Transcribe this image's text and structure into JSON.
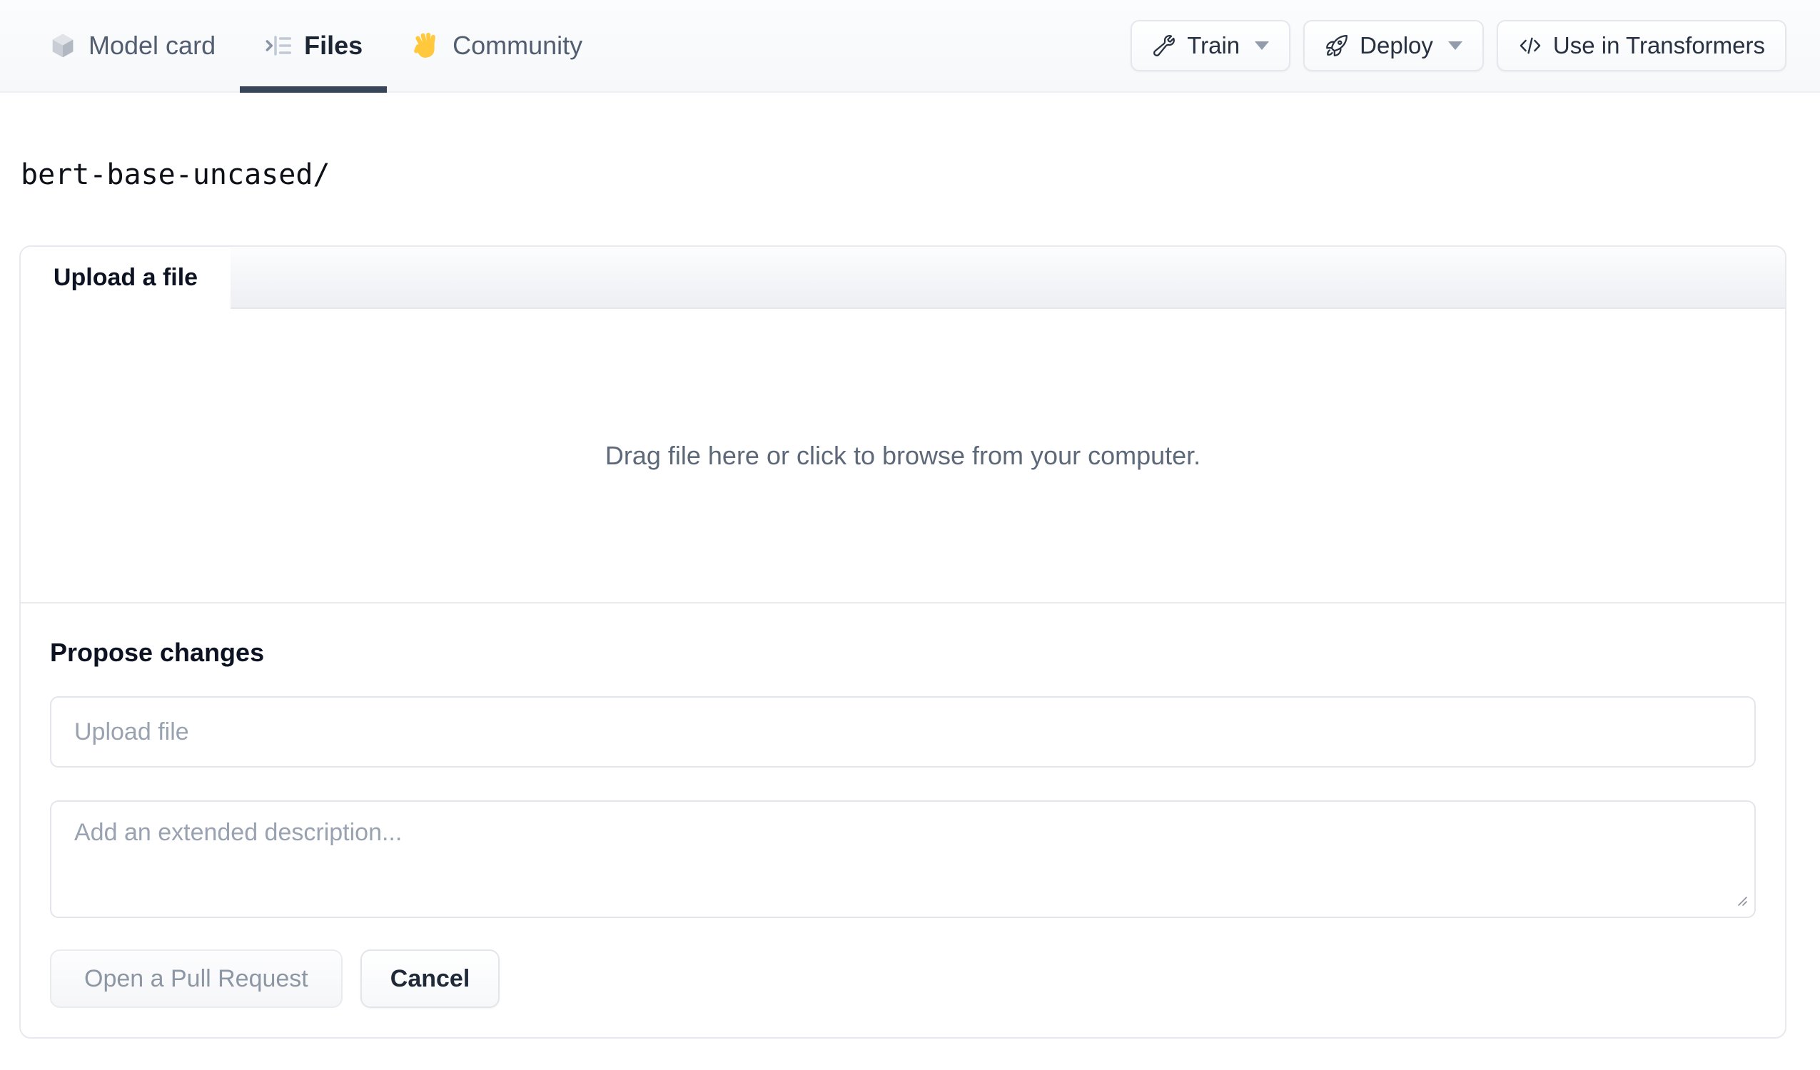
{
  "nav": {
    "tabs": [
      {
        "label": "Model card",
        "icon": "cube-icon",
        "active": false
      },
      {
        "label": "Files",
        "icon": "file-versions-icon",
        "active": true
      },
      {
        "label": "Community",
        "icon": "waving-hand-icon",
        "active": false
      }
    ],
    "actions": [
      {
        "label": "Train",
        "icon": "wrench-icon",
        "has_caret": true
      },
      {
        "label": "Deploy",
        "icon": "rocket-icon",
        "has_caret": true
      },
      {
        "label": "Use in Transformers",
        "icon": "code-icon",
        "has_caret": false
      }
    ]
  },
  "breadcrumb": {
    "path": "bert-base-uncased/"
  },
  "upload_panel": {
    "tab_label": "Upload a file",
    "dropzone_text": "Drag file here or click to browse from your computer.",
    "propose": {
      "heading": "Propose changes",
      "filename_placeholder": "Upload file",
      "description_placeholder": "Add an extended description...",
      "submit_label": "Open a Pull Request",
      "submit_disabled": true,
      "cancel_label": "Cancel"
    }
  },
  "colors": {
    "active_tab_underline": "#38445a",
    "nav_background": "#f8fafc",
    "panel_border": "#e7e9ee",
    "muted_text": "#5d6878",
    "placeholder_text": "#99a2b0",
    "disabled_button_text": "#8d97a4",
    "hand_emoji_yellow": "#ffc83d"
  }
}
